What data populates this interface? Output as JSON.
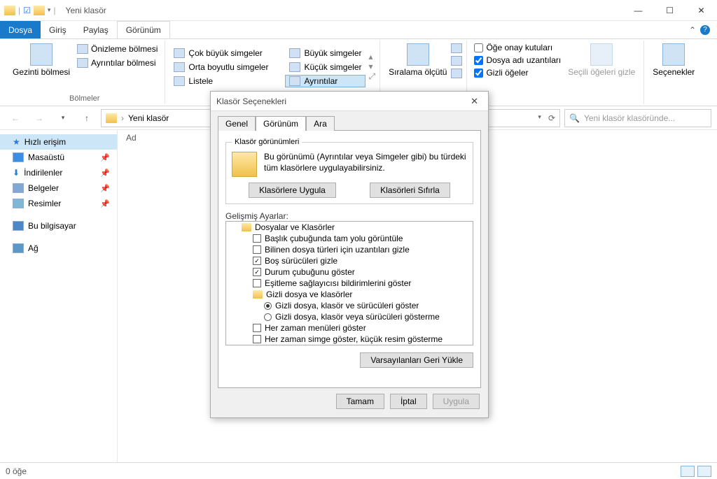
{
  "window": {
    "title": "Yeni klasör"
  },
  "menubar": {
    "file": "Dosya",
    "home": "Giriş",
    "share": "Paylaş",
    "view": "Görünüm"
  },
  "ribbon": {
    "panes": {
      "nav": "Gezinti bölmesi",
      "preview": "Önizleme bölmesi",
      "details": "Ayrıntılar bölmesi",
      "group": "Bölmeler"
    },
    "layouts": {
      "xl": "Çok büyük simgeler",
      "lg": "Büyük simgeler",
      "md": "Orta boyutlu simgeler",
      "sm": "Küçük simgeler",
      "list": "Listele",
      "details": "Ayrıntılar"
    },
    "sort": "Sıralama ölçütü",
    "checks": {
      "checkboxes": "Öğe onay kutuları",
      "ext": "Dosya adı uzantıları",
      "hidden": "Gizli öğeler"
    },
    "hideSelected": "Seçili öğeleri gizle",
    "options": "Seçenekler"
  },
  "address": {
    "path": "Yeni klasör"
  },
  "search": {
    "placeholder": "Yeni klasör klasöründe..."
  },
  "sidebar": {
    "quick": "Hızlı erişim",
    "desktop": "Masaüstü",
    "downloads": "İndirilenler",
    "documents": "Belgeler",
    "pictures": "Resimler",
    "thispc": "Bu bilgisayar",
    "network": "Ağ"
  },
  "columns": {
    "name": "Ad"
  },
  "status": {
    "count": "0 öğe"
  },
  "dialog": {
    "title": "Klasör Seçenekleri",
    "tabs": {
      "general": "Genel",
      "view": "Görünüm",
      "search": "Ara"
    },
    "folderViews": {
      "legend": "Klasör görünümleri",
      "desc": "Bu görünümü (Ayrıntılar veya Simgeler gibi) bu türdeki tüm klasörlere uygulayabilirsiniz.",
      "apply": "Klasörlere Uygula",
      "reset": "Klasörleri Sıfırla"
    },
    "advLabel": "Gelişmiş Ayarlar:",
    "tree": {
      "root": "Dosyalar ve Klasörler",
      "i1": "Başlık çubuğunda tam yolu görüntüle",
      "i2": "Bilinen dosya türleri için uzantıları gizle",
      "i3": "Boş sürücüleri gizle",
      "i4": "Durum çubuğunu göster",
      "i5": "Eşitleme sağlayıcısı bildirimlerini göster",
      "grp": "Gizli dosya ve klasörler",
      "r1": "Gizli dosya, klasör ve sürücüleri göster",
      "r2": "Gizli dosya, klasör veya sürücüleri gösterme",
      "i6": "Her zaman menüleri göster",
      "i7": "Her zaman simge göster, küçük resim gösterme"
    },
    "restore": "Varsayılanları Geri Yükle",
    "ok": "Tamam",
    "cancel": "İptal",
    "applyBtn": "Uygula"
  }
}
